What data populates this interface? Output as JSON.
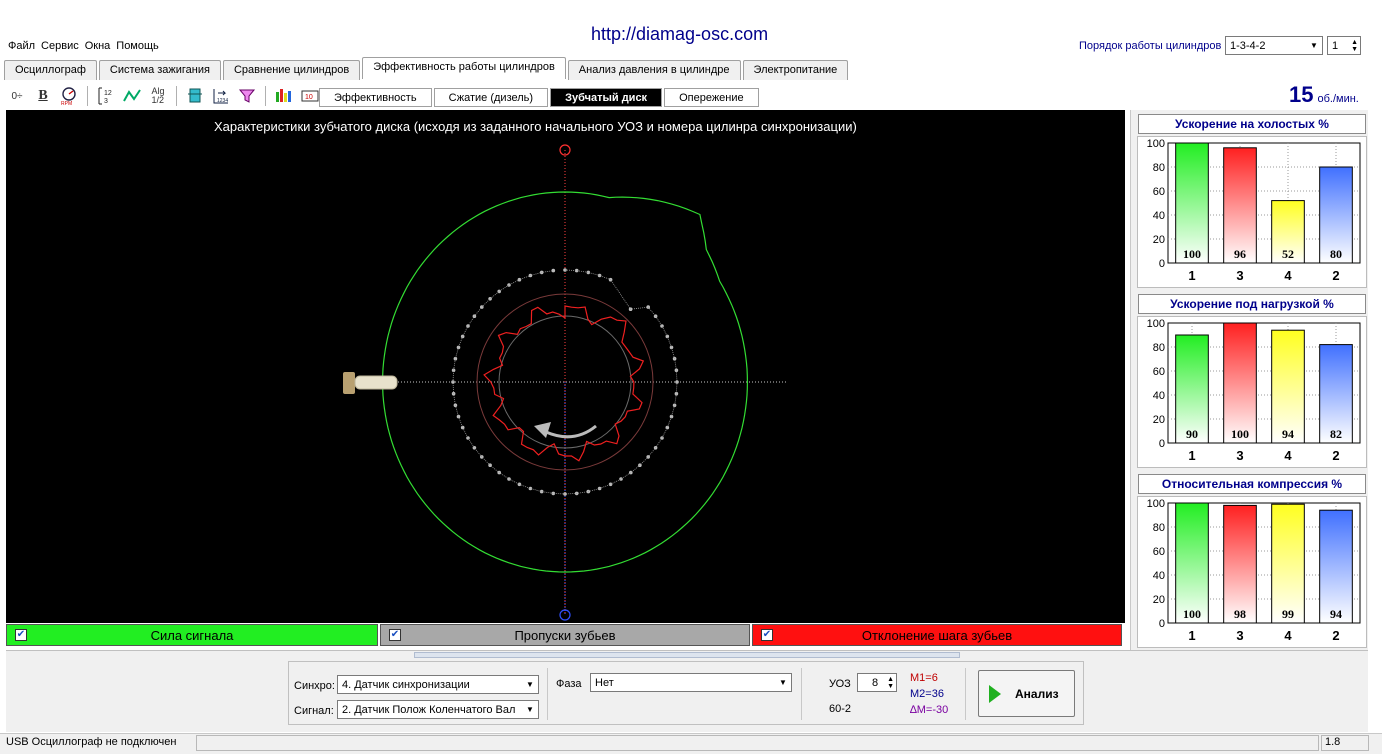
{
  "header": {
    "url": "http://diamag-osc.com",
    "menu": [
      "Файл",
      "Сервис",
      "Окна",
      "Помощь"
    ],
    "order_label": "Порядок работы цилиндров",
    "order_value": "1-3-4-2",
    "order_spin_value": "1"
  },
  "main_tabs": [
    {
      "label": "Осциллограф",
      "active": false
    },
    {
      "label": "Система зажигания",
      "active": false
    },
    {
      "label": "Сравнение цилиндров",
      "active": false
    },
    {
      "label": "Эффективность работы цилиндров",
      "active": true
    },
    {
      "label": "Анализ давления в цилиндре",
      "active": false
    },
    {
      "label": "Электропитание",
      "active": false
    }
  ],
  "toolbar_icons": [
    "zoom-vertical-icon",
    "bold-icon",
    "rpm-gauge-icon",
    "scale-icon",
    "curve-icon",
    "alg-half-icon",
    "cylinder-icon",
    "numbering-icon",
    "filter-icon",
    "bar-graph-icon",
    "counter-icon"
  ],
  "sub_tabs": [
    {
      "label": "Эффективность",
      "active": false
    },
    {
      "label": "Сжатие (дизель)",
      "active": false
    },
    {
      "label": "Зубчатый диск",
      "active": true
    },
    {
      "label": "Опережение",
      "active": false
    }
  ],
  "rpm": {
    "value": "15",
    "unit": "об./мин."
  },
  "scope": {
    "title": "Характеристики зубчатого диска (исходя из заданного начального УОЗ и номера цилинра синхронизации)",
    "teeth_count": 60,
    "missing_teeth": 2
  },
  "legend": [
    {
      "label": "Сила сигнала",
      "color": "#22ee22",
      "checked": true
    },
    {
      "label": "Пропуски зубьев",
      "color": "#a8a8a8",
      "checked": true
    },
    {
      "label": "Отклонение шага зубьев",
      "color": "#ff1010",
      "checked": true
    }
  ],
  "chart_data": [
    {
      "type": "bar",
      "title": "Ускорение на холостых %",
      "categories": [
        "1",
        "3",
        "4",
        "2"
      ],
      "values": [
        100,
        96,
        52,
        80
      ],
      "colors": [
        "#22ee22",
        "#ff2020",
        "#ffff20",
        "#4070ff"
      ],
      "ylim": [
        0,
        100
      ],
      "yticks": [
        0,
        20,
        40,
        60,
        80,
        100
      ],
      "grid": true
    },
    {
      "type": "bar",
      "title": "Ускорение под нагрузкой %",
      "categories": [
        "1",
        "3",
        "4",
        "2"
      ],
      "values": [
        90,
        100,
        94,
        82
      ],
      "colors": [
        "#22ee22",
        "#ff2020",
        "#ffff20",
        "#4070ff"
      ],
      "ylim": [
        0,
        100
      ],
      "yticks": [
        0,
        20,
        40,
        60,
        80,
        100
      ],
      "grid": true
    },
    {
      "type": "bar",
      "title": "Относительная компрессия %",
      "categories": [
        "1",
        "3",
        "4",
        "2"
      ],
      "values": [
        100,
        98,
        99,
        94
      ],
      "colors": [
        "#22ee22",
        "#ff2020",
        "#ffff20",
        "#4070ff"
      ],
      "ylim": [
        0,
        100
      ],
      "yticks": [
        0,
        20,
        40,
        60,
        80,
        100
      ],
      "grid": true
    }
  ],
  "controls": {
    "sync_label": "Синхро:",
    "sync_value": "4.  Датчик синхронизации",
    "signal_label": "Сигнал:",
    "signal_value": "2.  Датчик Полож Коленчатого Вал",
    "phase_label": "Фаза",
    "phase_value": "Нет",
    "uoz_label": "УОЗ",
    "uoz_value": "8",
    "teeth_label": "60-2",
    "m1": "M1=6",
    "m2": "M2=36",
    "dm": "∆M=-30",
    "analyze_label": "Анализ"
  },
  "status": {
    "text": "USB Осциллограф не подключен",
    "version": "1.8"
  }
}
